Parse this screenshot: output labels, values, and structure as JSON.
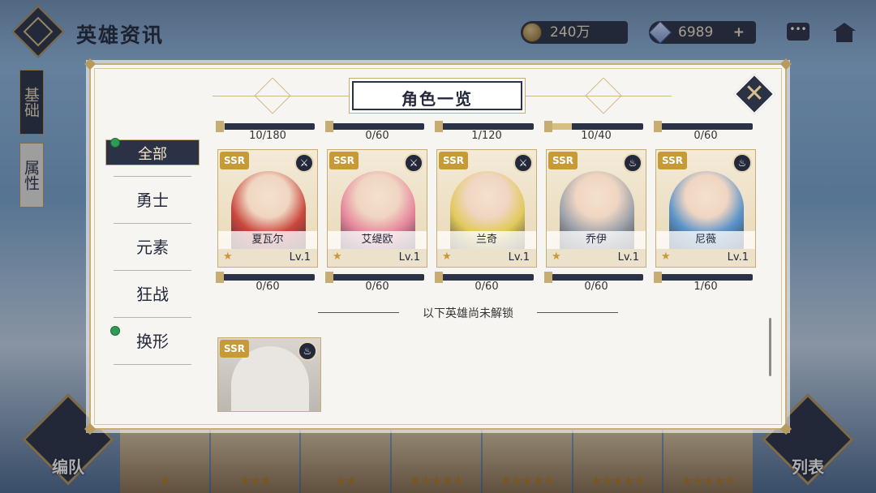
{
  "screen": {
    "title": "英雄资讯",
    "gold": "240万",
    "gems": "6989",
    "gems_plus": "+",
    "left_tabs": [
      "基础",
      "属性"
    ],
    "bottom_left": "编队",
    "bottom_right": "列表",
    "strip_stars": [
      "★",
      "★★★",
      "★★",
      "★★★★★",
      "★★★★★",
      "★★★★★",
      "★★★★★"
    ]
  },
  "modal": {
    "title": "角色一览",
    "categories": [
      {
        "label": "全部",
        "active": true,
        "dot": true
      },
      {
        "label": "勇士",
        "active": false,
        "dot": false
      },
      {
        "label": "元素",
        "active": false,
        "dot": false
      },
      {
        "label": "狂战",
        "active": false,
        "dot": false
      },
      {
        "label": "换形",
        "active": false,
        "dot": true
      }
    ],
    "heroes": [
      {
        "name": "夏瓦尔",
        "rarity": "SSR",
        "level": "Lv.1",
        "top_progress": "10/180",
        "top_fill": 0.056,
        "bottom_progress": "0/60",
        "bottom_fill": 0,
        "class_icon": "axe-icon",
        "color": "#c9473c"
      },
      {
        "name": "艾缇欧",
        "rarity": "SSR",
        "level": "Lv.1",
        "top_progress": "0/60",
        "top_fill": 0,
        "bottom_progress": "0/60",
        "bottom_fill": 0,
        "class_icon": "axe-icon",
        "color": "#e6879c"
      },
      {
        "name": "兰奇",
        "rarity": "SSR",
        "level": "Lv.1",
        "top_progress": "1/120",
        "top_fill": 0.008,
        "bottom_progress": "0/60",
        "bottom_fill": 0,
        "class_icon": "axe-icon",
        "color": "#e1c95c"
      },
      {
        "name": "乔伊",
        "rarity": "SSR",
        "level": "Lv.1",
        "top_progress": "10/40",
        "top_fill": 0.25,
        "bottom_progress": "0/60",
        "bottom_fill": 0,
        "class_icon": "flame-icon",
        "color": "#9ea3ab"
      },
      {
        "name": "尼薇",
        "rarity": "SSR",
        "level": "Lv.1",
        "top_progress": "0/60",
        "top_fill": 0,
        "bottom_progress": "1/60",
        "bottom_fill": 0.017,
        "class_icon": "flame-icon",
        "color": "#5b93c9"
      }
    ],
    "unlock_label": "以下英雄尚未解锁",
    "locked_hero": {
      "rarity": "SSR",
      "class_icon": "flame-icon"
    }
  }
}
